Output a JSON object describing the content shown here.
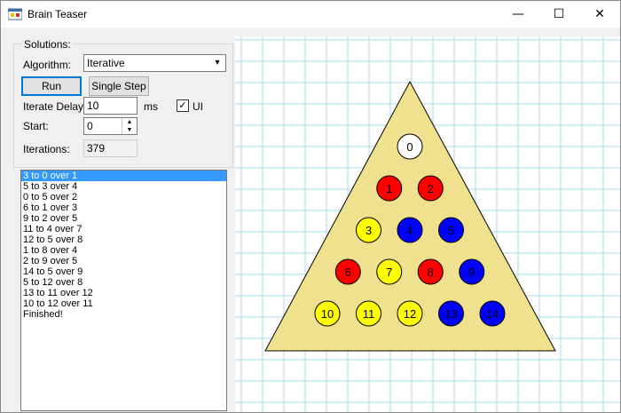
{
  "window": {
    "title": "Brain Teaser",
    "icon": "app-window-icon",
    "controls": {
      "minimize": "—",
      "maximize": "☐",
      "close": "✕"
    }
  },
  "solutions": {
    "group_label": "Solutions:",
    "algorithm_label": "Algorithm:",
    "algorithm_value": "Iterative",
    "run_label": "Run",
    "single_step_label": "Single Step",
    "iterate_delay_label": "Iterate Delay:",
    "iterate_delay_value": "10",
    "iterate_delay_unit": "ms",
    "ui_label": "UI",
    "ui_checked": true,
    "start_label": "Start:",
    "start_value": "0",
    "iterations_label": "Iterations:",
    "iterations_value": "379"
  },
  "moves": [
    "3 to 0 over 1",
    "5 to 3 over 4",
    "0 to 5 over 2",
    "6 to 1 over 3",
    "9 to 2 over 5",
    "11 to 4 over 7",
    "12 to 5 over 8",
    "1 to 8 over 4",
    "2 to 9 over 5",
    "14 to 5 over 9",
    "5 to 12 over 8",
    "13 to 11 over 12",
    "10 to 12 over 11",
    "Finished!"
  ],
  "selected_move_index": 0,
  "board": {
    "colors": {
      "white": "#ffffff",
      "red": "#ff0000",
      "yellow": "#ffff00",
      "blue": "#0000ff",
      "board": "#f0e18e",
      "grid": "#a8d8e8"
    },
    "pegs": [
      {
        "label": "0",
        "color": "white"
      },
      {
        "label": "1",
        "color": "red"
      },
      {
        "label": "2",
        "color": "red"
      },
      {
        "label": "3",
        "color": "yellow"
      },
      {
        "label": "4",
        "color": "blue"
      },
      {
        "label": "5",
        "color": "blue"
      },
      {
        "label": "6",
        "color": "red"
      },
      {
        "label": "7",
        "color": "yellow"
      },
      {
        "label": "8",
        "color": "red"
      },
      {
        "label": "9",
        "color": "blue"
      },
      {
        "label": "10",
        "color": "yellow"
      },
      {
        "label": "11",
        "color": "yellow"
      },
      {
        "label": "12",
        "color": "yellow"
      },
      {
        "label": "13",
        "color": "blue"
      },
      {
        "label": "14",
        "color": "blue"
      }
    ]
  }
}
